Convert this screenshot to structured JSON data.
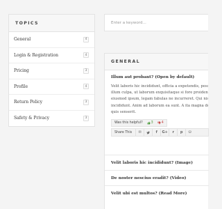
{
  "sidebar": {
    "title": "TOPICS",
    "items": [
      {
        "label": "General",
        "count": "4"
      },
      {
        "label": "Login & Registration",
        "count": "4"
      },
      {
        "label": "Pricing",
        "count": "3"
      },
      {
        "label": "Profile",
        "count": "4"
      },
      {
        "label": "Return Policy",
        "count": "3"
      },
      {
        "label": "Safety & Privacy",
        "count": "3"
      }
    ]
  },
  "search": {
    "placeholder": "Enter a keyword..."
  },
  "main": {
    "section_title": "GENERAL",
    "open_question": "Illum aut probant? (Open by default)",
    "answer_lines": [
      "Velit laboris hic incididunt, officia a expetendis, possunt",
      "illum culpa, ut laborum exquisitaque si fore proident illum",
      "eiusmod ipsum, legam fabulas ne incurreret. Qui nisi aute",
      "incididunt. Anim ad laborum ea sunt. A ita magna dolore",
      "quis senserit."
    ],
    "helpful": {
      "label": "Was this helpful?",
      "up_count": "3",
      "down_count": "4"
    },
    "share": {
      "label": "Share This",
      "icons": [
        {
          "name": "email-icon",
          "glyph": "✉"
        },
        {
          "name": "twitter-icon",
          "glyph": "♡"
        },
        {
          "name": "facebook-icon",
          "glyph": "f"
        },
        {
          "name": "google-plus-icon",
          "glyph": "G+"
        },
        {
          "name": "reddit-icon",
          "glyph": "r"
        },
        {
          "name": "pinterest-icon",
          "glyph": "p"
        },
        {
          "name": "vk-icon",
          "glyph": "⛁"
        }
      ]
    },
    "other_questions": [
      "Velit laboris hic incididunt? (Image)",
      "De noster nescius eradit? (Video)",
      "Velit ubi est multos? (Read More)"
    ]
  },
  "colors": {
    "vote_up": "#4a9a3a",
    "vote_down": "#c74a4a",
    "border": "#e3e3e3",
    "header_bg": "#f7f7f7"
  }
}
